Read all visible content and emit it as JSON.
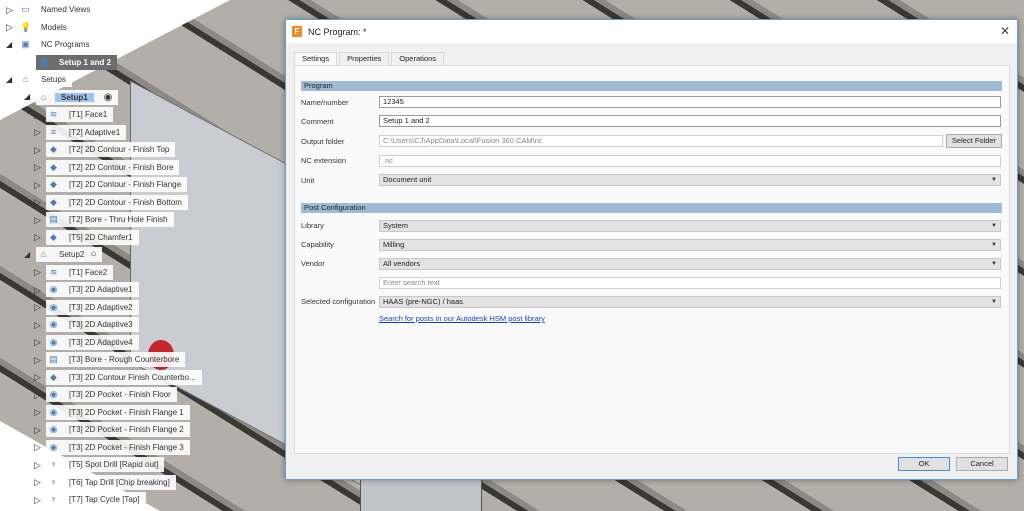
{
  "tree": [
    {
      "level": 0,
      "arrow": "closed",
      "icon": "folder-icon",
      "glyph": "▭",
      "label": "Named Views"
    },
    {
      "level": 0,
      "arrow": "closed",
      "icon": "lightbulb-icon",
      "glyph": "💡",
      "label": "Models"
    },
    {
      "level": 0,
      "arrow": "open",
      "icon": "nc-program-icon",
      "glyph": "▣",
      "label": "NC Programs"
    },
    {
      "level": 1,
      "arrow": "none",
      "icon": "nc-program-icon",
      "glyph": "▣",
      "label": "Setup 1 and 2",
      "style": "dark"
    },
    {
      "level": 0,
      "arrow": "open",
      "icon": "setup-folder-icon",
      "glyph": "⌂",
      "label": "Setups"
    },
    {
      "level": 1,
      "arrow": "open",
      "icon": "setup-icon",
      "glyph": "⌂",
      "label": "Setup1",
      "style": "sel",
      "radio": "◉"
    },
    {
      "level": 2,
      "arrow": "closed",
      "icon": "face-icon",
      "glyph": "≋",
      "label": "[T1] Face1"
    },
    {
      "level": 2,
      "arrow": "closed",
      "icon": "adaptive-icon",
      "glyph": "≡",
      "label": "[T2] Adaptive1"
    },
    {
      "level": 2,
      "arrow": "closed",
      "icon": "contour-icon",
      "glyph": "◆",
      "label": "[T2] 2D Contour - Finish Top"
    },
    {
      "level": 2,
      "arrow": "closed",
      "icon": "contour-icon",
      "glyph": "◆",
      "label": "[T2] 2D Contour - Finish Bore"
    },
    {
      "level": 2,
      "arrow": "closed",
      "icon": "contour-icon",
      "glyph": "◆",
      "label": "[T2] 2D Contour - Finish Flange"
    },
    {
      "level": 2,
      "arrow": "closed",
      "icon": "contour-icon",
      "glyph": "◆",
      "label": "[T2] 2D Contour - Finish Bottom"
    },
    {
      "level": 2,
      "arrow": "closed",
      "icon": "bore-icon",
      "glyph": "▤",
      "label": "[T2] Bore - Thru Hole Finish"
    },
    {
      "level": 2,
      "arrow": "closed",
      "icon": "chamfer-icon",
      "glyph": "◆",
      "label": "[T5] 2D Chamfer1"
    },
    {
      "level": 1,
      "arrow": "open",
      "icon": "setup-icon",
      "glyph": "⌂",
      "label": "Setup2",
      "radio": "○"
    },
    {
      "level": 2,
      "arrow": "closed",
      "icon": "face-icon",
      "glyph": "≋",
      "label": "[T1] Face2"
    },
    {
      "level": 2,
      "arrow": "closed",
      "icon": "adaptive-2d-icon",
      "glyph": "◉",
      "label": "[T3] 2D Adaptive1"
    },
    {
      "level": 2,
      "arrow": "closed",
      "icon": "adaptive-2d-icon",
      "glyph": "◉",
      "label": "[T3] 2D Adaptive2"
    },
    {
      "level": 2,
      "arrow": "closed",
      "icon": "adaptive-2d-icon",
      "glyph": "◉",
      "label": "[T3] 2D Adaptive3"
    },
    {
      "level": 2,
      "arrow": "closed",
      "icon": "adaptive-2d-icon",
      "glyph": "◉",
      "label": "[T3] 2D Adaptive4"
    },
    {
      "level": 2,
      "arrow": "closed",
      "icon": "bore-icon",
      "glyph": "▤",
      "label": "[T3] Bore - Rough Counterbore"
    },
    {
      "level": 2,
      "arrow": "closed",
      "icon": "contour-icon",
      "glyph": "◆",
      "label": "[T3] 2D Contour Finish Counterbo..."
    },
    {
      "level": 2,
      "arrow": "closed",
      "icon": "pocket-icon",
      "glyph": "◉",
      "label": "[T3] 2D Pocket - Finish Floor"
    },
    {
      "level": 2,
      "arrow": "closed",
      "icon": "pocket-icon",
      "glyph": "◉",
      "label": "[T3] 2D Pocket - Finish Flange 1"
    },
    {
      "level": 2,
      "arrow": "closed",
      "icon": "pocket-icon",
      "glyph": "◉",
      "label": "[T3] 2D Pocket - Finish Flange 2"
    },
    {
      "level": 2,
      "arrow": "closed",
      "icon": "pocket-icon",
      "glyph": "◉",
      "label": "[T3] 2D Pocket - Finish Flange 3"
    },
    {
      "level": 2,
      "arrow": "closed",
      "icon": "drill-icon",
      "glyph": "♆",
      "label": "[T5] Spot Drill [Rapid out]"
    },
    {
      "level": 2,
      "arrow": "closed",
      "icon": "drill-icon",
      "glyph": "♆",
      "label": "[T6] Tap Drill [Chip breaking]"
    },
    {
      "level": 2,
      "arrow": "closed",
      "icon": "drill-icon",
      "glyph": "♆",
      "label": "[T7] Tap Cycle [Tap]"
    }
  ],
  "dialog": {
    "title": "NC Program: *",
    "close": "✕",
    "tabs": [
      "Settings",
      "Properties",
      "Operations"
    ],
    "program_section": "Program",
    "name_label": "Name/number",
    "name_value": "12345",
    "comment_label": "Comment",
    "comment_value": "Setup 1 and 2",
    "output_label": "Output folder",
    "output_value": "C:\\Users\\CJ\\AppData\\Local\\Fusion 360 CAM\\nc",
    "select_folder": "Select Folder",
    "ext_label": "NC extension",
    "ext_value": ".nc",
    "unit_label": "Unit",
    "unit_value": "Document unit",
    "post_section": "Post Configuration",
    "library_label": "Library",
    "library_value": "System",
    "capability_label": "Capability",
    "capability_value": "Milling",
    "vendor_label": "Vendor",
    "vendor_value": "All vendors",
    "search_placeholder": "Enter search text",
    "config_label": "Selected configuration",
    "config_value": "HAAS (pre-NGC) / haas",
    "post_link": "Search for posts in our Autodesk HSM post library",
    "ok": "OK",
    "cancel": "Cancel"
  }
}
